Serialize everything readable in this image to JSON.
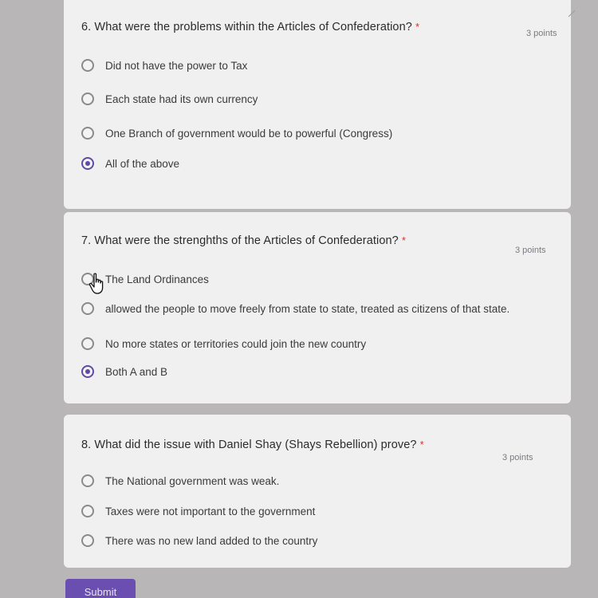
{
  "questions": [
    {
      "title": "6. What were the problems within the Articles of Confederation?",
      "required": "*",
      "points": "3 points",
      "options": [
        {
          "label": "Did not have the power to Tax",
          "selected": false
        },
        {
          "label": "Each state had its own currency",
          "selected": false
        },
        {
          "label": "One Branch of government would be to powerful (Congress)",
          "selected": false
        },
        {
          "label": "All of the above",
          "selected": true
        }
      ]
    },
    {
      "title": "7. What were the strenghths of the Articles of Confederation?",
      "required": "*",
      "points": "3 points",
      "options": [
        {
          "label": "The Land Ordinances",
          "selected": false
        },
        {
          "label": "allowed the people to move freely from state to state, treated as citizens of that state.",
          "selected": false
        },
        {
          "label": "No more states or territories could join the new country",
          "selected": false
        },
        {
          "label": "Both A and B",
          "selected": true
        }
      ]
    },
    {
      "title": "8. What did the issue with Daniel Shay (Shays Rebellion) prove?",
      "required": "*",
      "points": "3 points",
      "options": [
        {
          "label": "The National government was weak.",
          "selected": false
        },
        {
          "label": "Taxes were not important to the government",
          "selected": false
        },
        {
          "label": "There was no new land added to the country",
          "selected": false
        }
      ]
    }
  ],
  "submit_label": "Submit",
  "colors": {
    "accent": "#5f4aa6",
    "required": "#d93025",
    "card": "#f1f0f0",
    "background": "#b9b6b7"
  },
  "icons": {
    "pointer": "hand-pointer-icon",
    "radio": "radio-icon"
  }
}
